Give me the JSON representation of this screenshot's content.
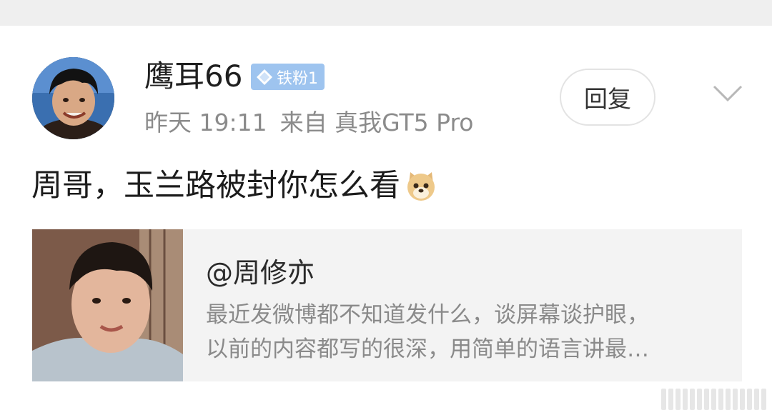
{
  "post": {
    "username": "鹰耳66",
    "badge_label": "铁粉1",
    "time": "昨天 19:11",
    "source": "来自 真我GT5 Pro",
    "reply_label": "回复",
    "text": "周哥，玉兰路被封你怎么看",
    "emoji_icon": "doge-emoji-icon",
    "colors": {
      "badge": "#9ec4ef",
      "meta_text": "#8b8b8b",
      "card_bg": "#f3f3f3"
    }
  },
  "quoted": {
    "mention": "@周修亦",
    "lines": [
      "最近发微博都不知道发什么，谈屏幕谈护眼，",
      "以前的内容都写的很深，用简单的语言讲最…"
    ]
  }
}
